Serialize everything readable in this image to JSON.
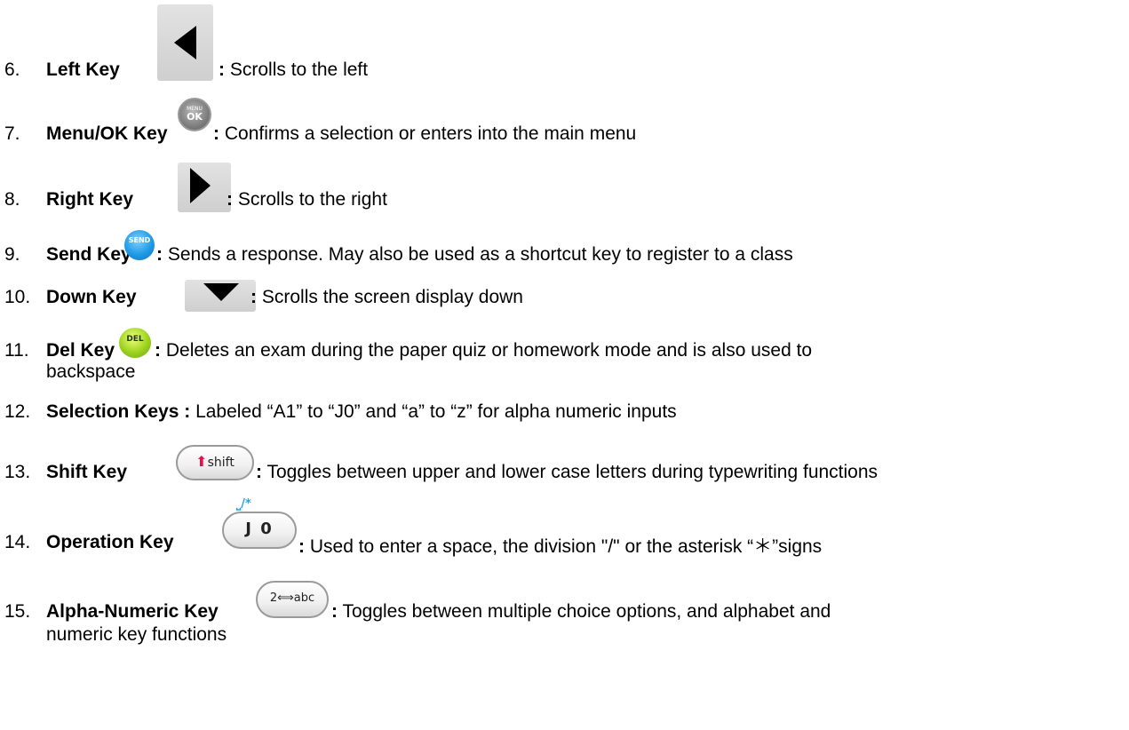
{
  "items": [
    {
      "num": "6.",
      "label": "Left Key",
      "desc": "Scrolls to the left",
      "icon": "left-arrow-key-icon"
    },
    {
      "num": "7.",
      "label": "Menu/OK Key",
      "desc": "Confirms a selection or enters into the main menu",
      "icon": "menu-ok-key-icon",
      "icon_text_top": "MENU",
      "icon_text_main": "OK"
    },
    {
      "num": "8.",
      "label": "Right Key",
      "desc": "Scrolls to the right",
      "icon": "right-arrow-key-icon"
    },
    {
      "num": "9.",
      "label": "Send Key",
      "desc": "Sends a response. May also be used as a shortcut key to register to a class",
      "icon": "send-key-icon",
      "icon_text": "SEND"
    },
    {
      "num": "10.",
      "label": "Down Key",
      "desc": "Scrolls the screen display down",
      "icon": "down-arrow-key-icon"
    },
    {
      "num": "11.",
      "label": "Del Key",
      "desc": "Deletes an exam during the paper quiz or homework mode and is also used to",
      "desc_cont": "backspace",
      "icon": "del-key-icon",
      "icon_text": "DEL"
    },
    {
      "num": "12.",
      "label": "Selection Keys :",
      "desc": "Labeled “A1” to “J0” and “a” to “z” for alpha numeric inputs"
    },
    {
      "num": "13.",
      "label": "Shift Key",
      "desc": "Toggles between upper and lower case letters during typewriting functions",
      "icon": "shift-key-icon",
      "icon_text": "shift"
    },
    {
      "num": "14.",
      "label": "Operation Key",
      "desc": "Used to enter a space, the division \"/\" or the asterisk “＊”signs",
      "icon": "operation-key-icon",
      "icon_text": "J 0",
      "icon_sup": "⎵/*"
    },
    {
      "num": "15.",
      "label": "Alpha-Numeric Key",
      "desc": "Toggles between multiple choice options, and alphabet and",
      "desc_cont": "numeric key functions",
      "icon": "alpha-numeric-key-icon",
      "icon_text": "2⟺abc"
    }
  ],
  "colon": ":",
  "colors": {
    "send": "#1f9ae6",
    "del": "#9cd21e",
    "shift_arrow": "#e0134f",
    "operation_sup": "#2aa0e8"
  }
}
